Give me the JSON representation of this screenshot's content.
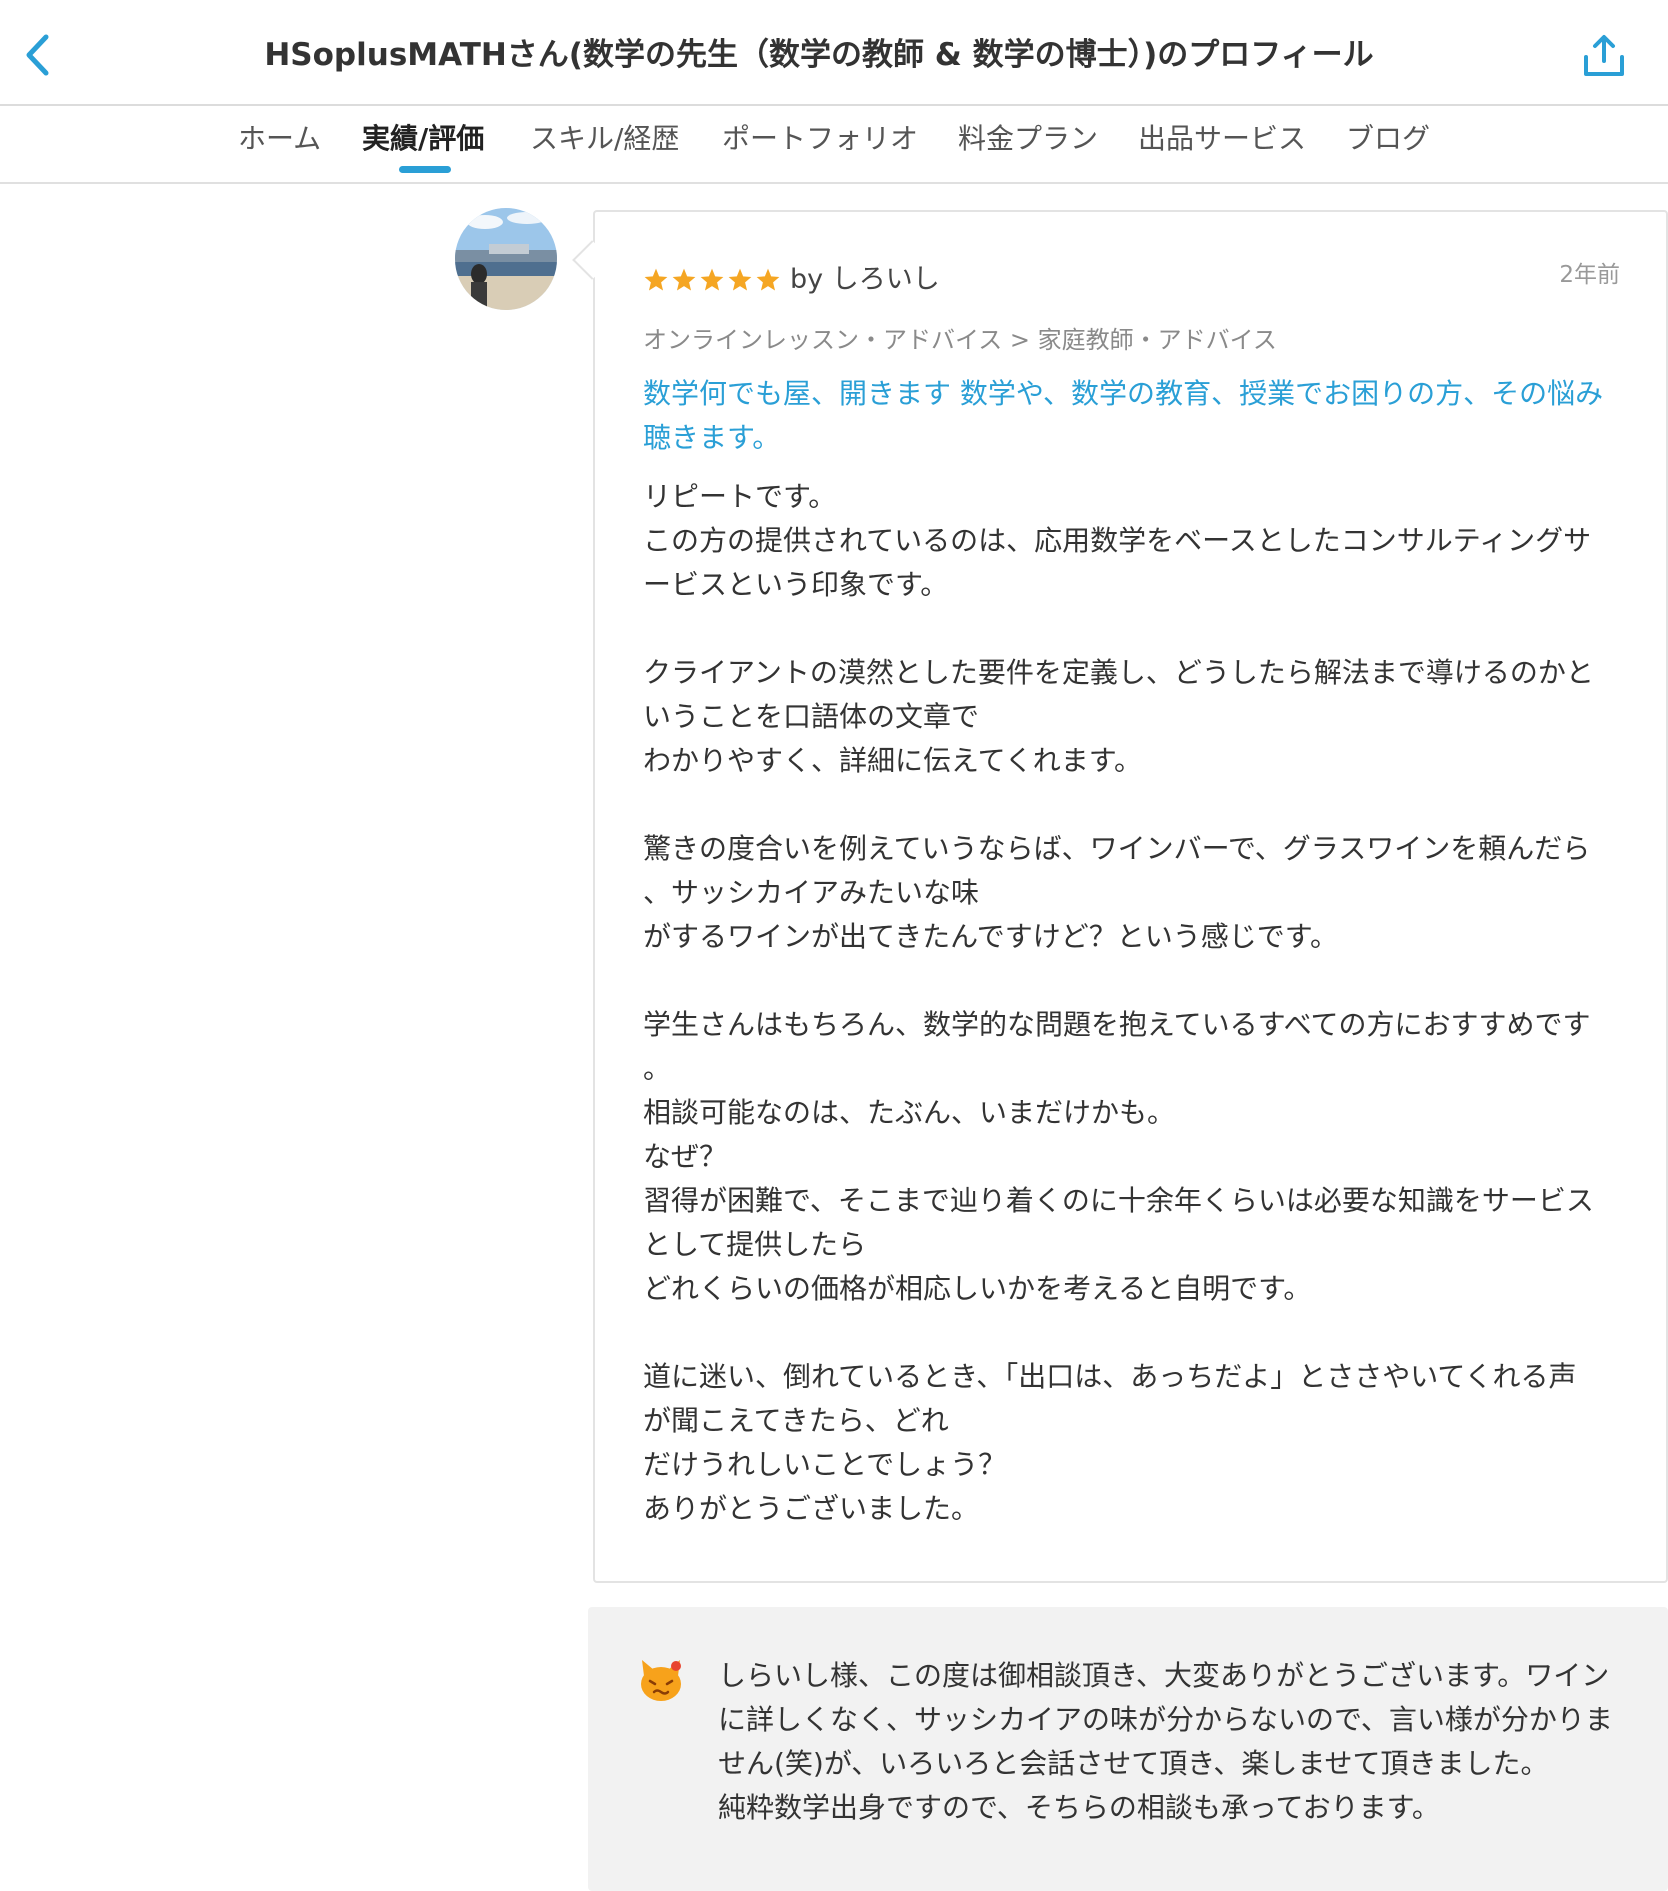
{
  "header": {
    "title": "HSoplusMATHさん(数学の先生（数学の教師 & 数学の博士）)のプロフィール",
    "back_icon": "chevron-left-icon",
    "share_icon": "share-icon",
    "accent_color": "#2a9fd6"
  },
  "tabs": [
    {
      "label": "ホーム",
      "active": false
    },
    {
      "label": "実績/評価",
      "active": true
    },
    {
      "label": "スキル/経歴",
      "active": false
    },
    {
      "label": "ポートフォリオ",
      "active": false
    },
    {
      "label": "料金プラン",
      "active": false
    },
    {
      "label": "出品サービス",
      "active": false
    },
    {
      "label": "ブログ",
      "active": false
    }
  ],
  "review": {
    "rating": 5,
    "rating_max": 5,
    "star_color": "#f5a623",
    "reviewer": "by しろいし",
    "date": "2年前",
    "category": "オンラインレッスン・アドバイス > 家庭教師・アドバイス",
    "service_title_lines": [
      "数学何でも屋、開きます 数学や、数学の教育、授業でお困りの方、その悩み",
      "聴きます。"
    ],
    "body_lines": [
      "リピートです。",
      "この方の提供されているのは、応用数学をベースとしたコンサルティングサ",
      "ービスという印象です。",
      "",
      "クライアントの漠然とした要件を定義し、どうしたら解法まで導けるのかと",
      "いうことを口語体の文章で",
      "わかりやすく、詳細に伝えてくれます。",
      "",
      "驚きの度合いを例えていうならば、ワインバーで、グラスワインを頼んだら",
      "、サッシカイアみたいな味",
      "がするワインが出てきたんですけど？という感じです。",
      "",
      "学生さんはもちろん、数学的な問題を抱えているすべての方におすすめです",
      "。",
      "相談可能なのは、たぶん、いまだけかも。",
      "なぜ？",
      "習得が困難で、そこまで辿り着くのに十余年くらいは必要な知識をサービス",
      "として提供したら",
      "どれくらいの価格が相応しいかを考えると自明です。",
      "",
      "道に迷い、倒れているとき、「出口は、あっちだよ」とささやいてくれる声",
      "が聞こえてきたら、どれ",
      "だけうれしいことでしょう？",
      "ありがとうございました。"
    ]
  },
  "reply": {
    "icon": "cat-face-icon",
    "lines": [
      "しらいし様、この度は御相談頂き、大変ありがとうございます。ワイン",
      "に詳しくなく、サッシカイアの味が分からないので、言い様が分かりま",
      "せん(笑)が、いろいろと会話させて頂き、楽しませて頂きました。",
      "純粋数学出身ですので、そちらの相談も承っております。"
    ]
  }
}
